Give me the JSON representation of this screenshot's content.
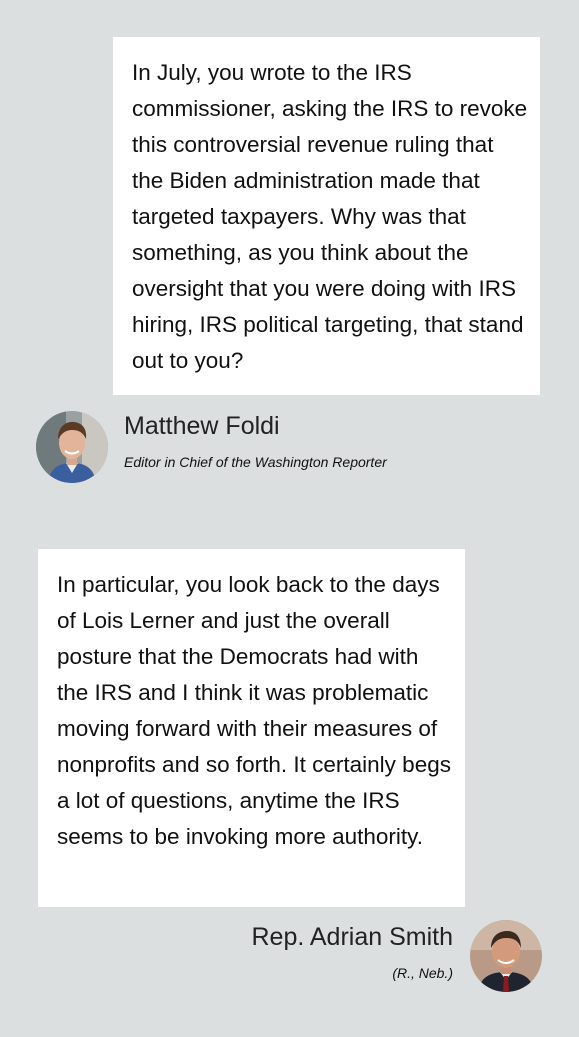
{
  "exchange": {
    "question": {
      "text": "In July, you wrote to the IRS commissioner, asking the IRS to revoke this controversial revenue ruling that the Biden administration made that targeted taxpayers. Why was that something, as you think about the oversight that you were doing with IRS hiring, IRS political targeting, that stand out to you?",
      "speaker_name": "Matthew Foldi",
      "speaker_title": "Editor in Chief of the Washington Reporter"
    },
    "answer": {
      "text": "In particular, you look back to the days of Lois Lerner and just the overall posture that the Democrats had with the IRS and I think it was problematic moving forward with their measures of nonprofits and so forth. It certainly begs a lot of questions, anytime the IRS seems to be invoking more authority.",
      "speaker_name": "Rep. Adrian Smith",
      "speaker_title": "(R., Neb.)"
    }
  },
  "colors": {
    "background": "#dcdfe0",
    "bubble": "#ffffff",
    "text": "#111111"
  }
}
